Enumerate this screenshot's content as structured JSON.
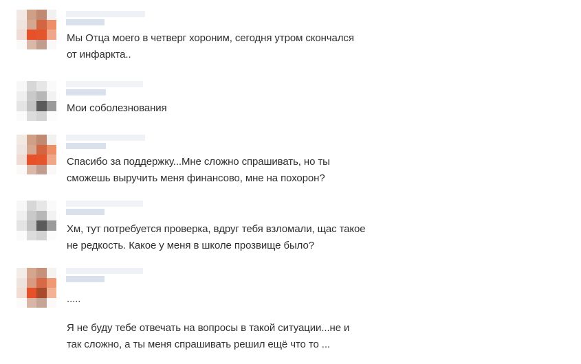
{
  "messages": [
    {
      "author": "friend",
      "text": "Мы Отца моего в четверг хороним, сегодня утром скончался\nот инфаркта.."
    },
    {
      "author": "me",
      "text": "Мои соболезнования"
    },
    {
      "author": "friend",
      "text": "Спасибо за поддержку...Мне сложно спрашивать, но ты\nсможешь выручить меня финансово, мне на похорон?"
    },
    {
      "author": "me",
      "text": "Хм, тут потребуется проверка, вдруг тебя взломали, щас такое\nне редкость. Какое у меня в школе прозвище было?"
    },
    {
      "author": "friend",
      "text": "....."
    },
    {
      "author": "friend",
      "text": "Я не буду тебе отвечать на вопросы в такой ситуации...не и\nтак сложно, а ты меня спрашивать решил ещё что то ..."
    }
  ],
  "colors": {
    "friend_avatar_accent": "#e8502a",
    "me_avatar_accent": "#5a5a5a",
    "name_blur": "#dfe6ee"
  }
}
